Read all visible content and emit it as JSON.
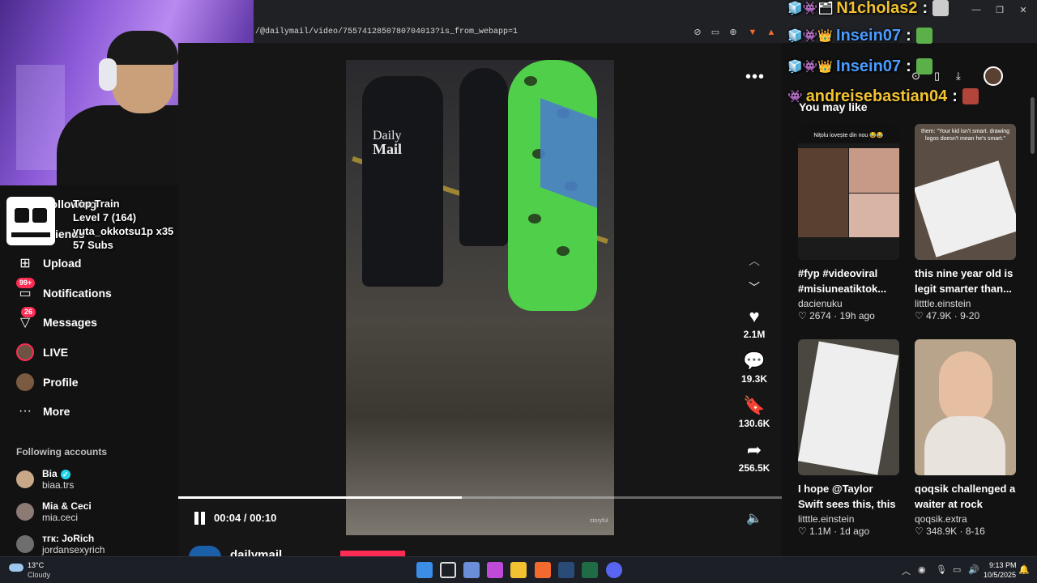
{
  "browser": {
    "url": "/@dailymail/video/7557412850780704013?is_from_webapp=1",
    "window_controls": [
      "—",
      "❐",
      "✕"
    ]
  },
  "overlay": {
    "train_title": "Top Train",
    "train_level": "Level 7  (164)",
    "train_user": "yuta_okkotsu1p x35",
    "train_subs": "57 Subs",
    "chat": [
      {
        "user": "N1cholas2",
        "color": "#f2c230"
      },
      {
        "user": "Insein07",
        "color": "#4a9cff"
      },
      {
        "user": "Insein07",
        "color": "#4a9cff"
      },
      {
        "user": "andreisebastian04",
        "color": "#f2c230"
      }
    ]
  },
  "sidebar": {
    "partial_items": [
      "Following",
      "Friends"
    ],
    "items": [
      {
        "label": "Upload",
        "icon": "upload-icon",
        "badge": ""
      },
      {
        "label": "Notifications",
        "icon": "notifications-icon",
        "badge": "99+"
      },
      {
        "label": "Messages",
        "icon": "messages-icon",
        "badge": "26"
      },
      {
        "label": "LIVE",
        "icon": "live-icon",
        "badge": ""
      },
      {
        "label": "Profile",
        "icon": "profile-icon",
        "badge": ""
      },
      {
        "label": "More",
        "icon": "more-icon",
        "badge": ""
      }
    ],
    "following_title": "Following accounts",
    "accounts": [
      {
        "name": "Bia",
        "handle": "biaa.trs",
        "verified": true
      },
      {
        "name": "Mia & Ceci",
        "handle": "mia.ceci",
        "verified": false
      },
      {
        "name": "тгк: JoRich",
        "handle": "jordansexyrich",
        "verified": false
      }
    ]
  },
  "video": {
    "logo_line1": "Daily",
    "logo_line2": "Mail",
    "watermark": "storyful",
    "time": "00:04 / 00:10",
    "progress": 0.47,
    "actions": {
      "likes": "2.1M",
      "comments": "19.3K",
      "saves": "130.6K",
      "shares": "256.5K"
    },
    "author": "dailymail"
  },
  "recommendations": {
    "title": "You may like",
    "cards": [
      {
        "title": "#fyp #videoviral #misiuneatiktok...",
        "author": "dacienuku",
        "likes": "2674",
        "age": "19h ago",
        "thumb_text": "Nițolu iovește din nou 😂😂"
      },
      {
        "title": "this nine year old is legit smarter than...",
        "author": "litttle.einstein",
        "likes": "47.9K",
        "age": "9-20",
        "thumb_text": "them: \"Your kid isn't smart. drawing logos doesn't mean he's smart.\""
      },
      {
        "title": "I hope @Taylor Swift sees this, this was...",
        "author": "litttle.einstein",
        "likes": "1.1M",
        "age": "1d ago",
        "thumb_text": ""
      },
      {
        "title": "qoqsik challenged a waiter at rock pape...",
        "author": "qoqsik.extra",
        "likes": "348.9K",
        "age": "8-16",
        "thumb_text": ""
      }
    ]
  },
  "taskbar": {
    "temp": "13°C",
    "weather": "Cloudy",
    "time": "9:13 PM",
    "date": "10/5/2025"
  },
  "colors": {
    "accent": "#fe2c55",
    "bg": "#121212"
  }
}
